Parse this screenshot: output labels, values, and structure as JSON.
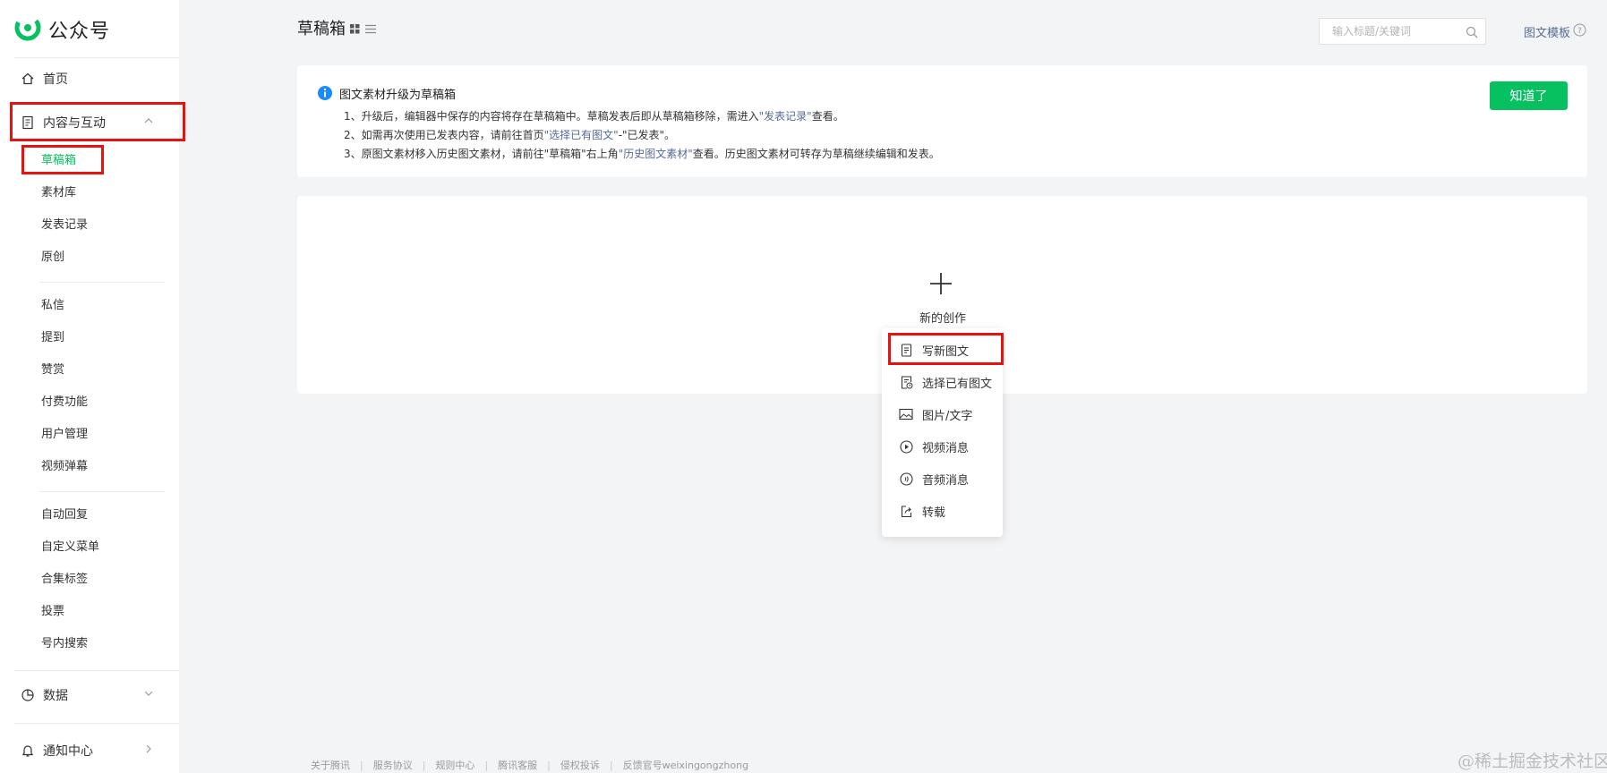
{
  "app": {
    "name": "公众号"
  },
  "sidebar": {
    "home": "首页",
    "content_group": "内容与互动",
    "content_items": [
      "草稿箱",
      "素材库",
      "发表记录",
      "原创"
    ],
    "interact_items": [
      "私信",
      "提到",
      "赞赏",
      "付费功能",
      "用户管理",
      "视频弹幕"
    ],
    "tool_items": [
      "自动回复",
      "自定义菜单",
      "合集标签",
      "投票",
      "号内搜索"
    ],
    "data_group": "数据",
    "notice_group": "通知中心"
  },
  "header": {
    "title": "草稿箱",
    "search_placeholder": "输入标题/关键词",
    "template_link": "图文模板"
  },
  "notice": {
    "title": "图文素材升级为草稿箱",
    "line1_a": "1、升级后，编辑器中保存的内容将存在草稿箱中。草稿发表后即从草稿箱移除，需进入",
    "line1_link": "\"发表记录\"",
    "line1_b": "查看。",
    "line2_a": "2、如需再次使用已发表内容，请前往首页",
    "line2_link": "\"选择已有图文\"",
    "line2_b": "-\"已发表\"。",
    "line3_a": "3、原图文素材移入历史图文素材，请前往\"草稿箱\"右上角",
    "line3_link": "\"历史图文素材\"",
    "line3_b": "查看。历史图文素材可转存为草稿继续编辑和发表。",
    "ok_button": "知道了"
  },
  "create": {
    "label": "新的创作",
    "menu": [
      {
        "label": "写新图文",
        "icon": "document-icon"
      },
      {
        "label": "选择已有图文",
        "icon": "document-clock-icon"
      },
      {
        "label": "图片/文字",
        "icon": "image-icon"
      },
      {
        "label": "视频消息",
        "icon": "play-icon"
      },
      {
        "label": "音频消息",
        "icon": "audio-icon"
      },
      {
        "label": "转载",
        "icon": "share-icon"
      }
    ]
  },
  "footer": {
    "links": [
      "关于腾讯",
      "服务协议",
      "规则中心",
      "腾讯客服",
      "侵权投诉",
      "反馈官号weixingongzhong"
    ]
  },
  "watermark": "@稀土掘金技术社区",
  "colors": {
    "accent": "#07c160",
    "link": "#576b95",
    "highlight": "#e5120f"
  }
}
